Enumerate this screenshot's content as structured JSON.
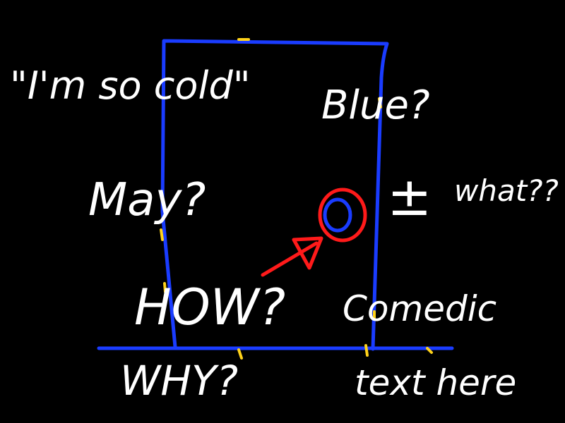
{
  "colors": {
    "background": "#000000",
    "text": "#ffffff",
    "box_outline": "#1a3cff",
    "target_outer": "#ff1a1a",
    "target_inner": "#1a3cff",
    "arrow": "#ff1a1a",
    "marks": "#ffd21a"
  },
  "labels": {
    "quote": "\"I'm so cold\"",
    "blue": "Blue?",
    "may": "May?",
    "how": "HOW?",
    "plusminus": "±",
    "what": "what??",
    "comedic": "Comedic",
    "text_here": "text here",
    "why": "WHY?"
  }
}
